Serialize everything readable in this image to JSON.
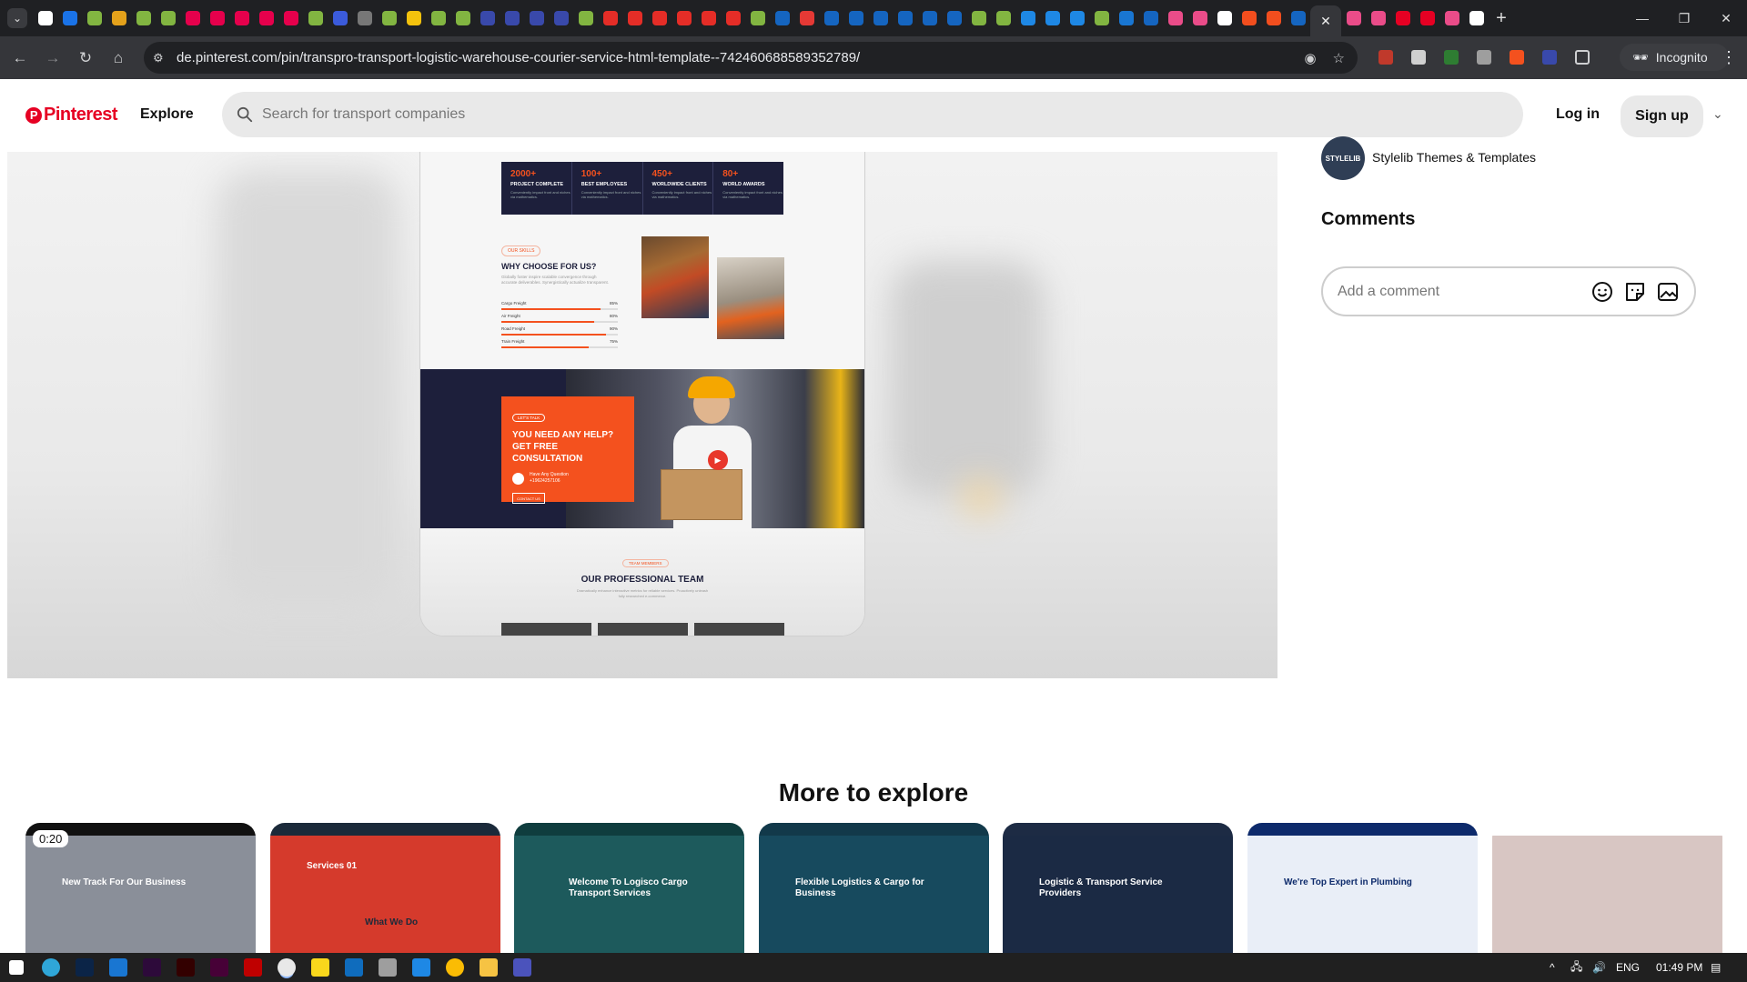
{
  "browser": {
    "tab_favicons": [
      {
        "name": "google-tab-icon",
        "color": "#ffffff"
      },
      {
        "name": "calendar-tab-icon",
        "color": "#1a73e8"
      },
      {
        "name": "envato-tab-icon",
        "color": "#82b541"
      },
      {
        "name": "brand-tab-icon",
        "color": "#e4a11b"
      },
      {
        "name": "envato-tab-icon",
        "color": "#82b541"
      },
      {
        "name": "envato-tab-icon",
        "color": "#82b541"
      },
      {
        "name": "opera-tab-icon",
        "color": "#e6004c"
      },
      {
        "name": "opera-tab-icon",
        "color": "#e6004c"
      },
      {
        "name": "opera-tab-icon",
        "color": "#e6004c"
      },
      {
        "name": "opera-tab-icon",
        "color": "#e6004c"
      },
      {
        "name": "opera-tab-icon",
        "color": "#e6004c"
      },
      {
        "name": "envato-tab-icon",
        "color": "#82b541"
      },
      {
        "name": "le-tab-icon",
        "color": "#3b5bdb"
      },
      {
        "name": "globe-tab-icon",
        "color": "#777777"
      },
      {
        "name": "envato-tab-icon",
        "color": "#82b541"
      },
      {
        "name": "wrench-tab-icon",
        "color": "#f4c20d"
      },
      {
        "name": "envato-tab-icon",
        "color": "#82b541"
      },
      {
        "name": "envato-tab-icon",
        "color": "#82b541"
      },
      {
        "name": "c-tab-icon",
        "color": "#3949ab"
      },
      {
        "name": "c-tab-icon",
        "color": "#3949ab"
      },
      {
        "name": "c-tab-icon",
        "color": "#3949ab"
      },
      {
        "name": "c-tab-icon",
        "color": "#3949ab"
      },
      {
        "name": "envato-tab-icon",
        "color": "#82b541"
      },
      {
        "name": "red-tab-icon",
        "color": "#e52d27"
      },
      {
        "name": "red-tab-icon",
        "color": "#e52d27"
      },
      {
        "name": "red-tab-icon",
        "color": "#e52d27"
      },
      {
        "name": "red-tab-icon",
        "color": "#e52d27"
      },
      {
        "name": "red-tab-icon",
        "color": "#e52d27"
      },
      {
        "name": "red-tab-icon",
        "color": "#e52d27"
      },
      {
        "name": "envato-tab-icon",
        "color": "#82b541"
      },
      {
        "name": "a-tab-icon",
        "color": "#1565c0"
      },
      {
        "name": "m-tab-icon",
        "color": "#e53935"
      },
      {
        "name": "a-tab-icon",
        "color": "#1565c0"
      },
      {
        "name": "a-tab-icon",
        "color": "#1565c0"
      },
      {
        "name": "a-tab-icon",
        "color": "#1565c0"
      },
      {
        "name": "a-tab-icon",
        "color": "#1565c0"
      },
      {
        "name": "a-tab-icon",
        "color": "#1565c0"
      },
      {
        "name": "a-tab-icon",
        "color": "#1565c0"
      },
      {
        "name": "envato-tab-icon",
        "color": "#82b541"
      },
      {
        "name": "envato-tab-icon",
        "color": "#82b541"
      },
      {
        "name": "edge-tab-icon",
        "color": "#1e88e5"
      },
      {
        "name": "edge-tab-icon",
        "color": "#1e88e5"
      },
      {
        "name": "edge-tab-icon",
        "color": "#1e88e5"
      },
      {
        "name": "envato-tab-icon",
        "color": "#82b541"
      },
      {
        "name": "word-tab-icon",
        "color": "#1976d2"
      },
      {
        "name": "forms-tab-icon",
        "color": "#1565c0"
      },
      {
        "name": "dribbble-tab-icon",
        "color": "#ea4c89"
      },
      {
        "name": "dribbble-tab-icon",
        "color": "#ea4c89"
      },
      {
        "name": "chrome-tab-icon",
        "color": "#ffffff"
      },
      {
        "name": "figma-tab-icon",
        "color": "#f24e1e"
      },
      {
        "name": "figma-tab-icon",
        "color": "#f24e1e"
      },
      {
        "name": "forms-tab-icon",
        "color": "#1565c0"
      }
    ],
    "active_tab_close": "✕",
    "tab_favicons_after": [
      {
        "name": "dribbble-tab-icon",
        "color": "#ea4c89"
      },
      {
        "name": "dribbble-tab-icon",
        "color": "#ea4c89"
      },
      {
        "name": "pinterest-tab-icon",
        "color": "#e60023"
      },
      {
        "name": "pinterest-tab-icon",
        "color": "#e60023"
      },
      {
        "name": "dribbble-tab-icon",
        "color": "#ea4c89"
      },
      {
        "name": "notion-tab-icon",
        "color": "#ffffff"
      }
    ],
    "new_tab": "+",
    "url": "de.pinterest.com/pin/transpro-transport-logistic-warehouse-courier-service-html-template--742460688589352789/",
    "incognito_label": "Incognito"
  },
  "header": {
    "logo_text": "Pinterest",
    "explore_label": "Explore",
    "search_placeholder": "Search for transport companies",
    "login_label": "Log in",
    "signup_label": "Sign up",
    "colors": {
      "brand": "#e60023"
    }
  },
  "pin": {
    "stats": [
      {
        "num": "2000+",
        "label": "PROJECT COMPLETE",
        "sub": "Conveniently impact front and niches via mathematics."
      },
      {
        "num": "100+",
        "label": "BEST EMPLOYEES",
        "sub": "Conveniently impact front and niches via mathematics."
      },
      {
        "num": "450+",
        "label": "WORLDWIDE CLIENTS",
        "sub": "Conveniently impact front and niches via mathematics."
      },
      {
        "num": "80+",
        "label": "WORLD AWARDS",
        "sub": "Conveniently impact front and niches via mathematics."
      }
    ],
    "why_tag": "OUR SKILLS",
    "why_title": "WHY CHOOSE FOR US?",
    "why_desc": "Globally foster inspire scalable convergence through accurate deliverables. Synergistically actualize transparent.",
    "skills": [
      {
        "label": "Cargo Freight",
        "value": "85%",
        "level": 0.85
      },
      {
        "label": "Air Freight",
        "value": "80%",
        "level": 0.8
      },
      {
        "label": "Road Freight",
        "value": "90%",
        "level": 0.9
      },
      {
        "label": "Train Freight",
        "value": "75%",
        "level": 0.75
      }
    ],
    "help_tag": "LET'S TALK",
    "help_title": "YOU NEED ANY HELP? GET FREE CONSULTATION",
    "help_phone_label": "Have Any Question",
    "help_phone": "+19624257106",
    "help_button": "CONTACT US",
    "team_tag": "TEAM MEMBERS",
    "team_title": "OUR PROFESSIONAL TEAM",
    "team_desc": "Dramatically enhance interactive metrics for reliable services. Proactively unleash fully researched e-commerce."
  },
  "side": {
    "author_avatar_text": "STYLELIB",
    "author_name": "Stylelib Themes & Templates",
    "comments_title": "Comments",
    "comment_placeholder": "Add a comment"
  },
  "more": {
    "title": "More to explore",
    "duration": "0:20",
    "cards": [
      {
        "headline": "New Track For Our Business",
        "nav_color": "#111111",
        "hero_color": "#8a8f99"
      },
      {
        "headline": "Services 01",
        "nav_color": "#1b2a3a",
        "hero_color": "#d53a2c"
      },
      {
        "headline": "Welcome To Logisco Cargo Transport Services",
        "nav_color": "#0f3d3e",
        "hero_color": "#1d5a5c"
      },
      {
        "headline": "Flexible Logistics & Cargo for Business",
        "nav_color": "#12394a",
        "hero_color": "#174a5e"
      },
      {
        "headline": "Logistic & Transport Service Providers",
        "nav_color": "#1d2b44",
        "hero_color": "#1b2a44"
      },
      {
        "headline": "We're Top Expert in Plumbing",
        "nav_color": "#0d2a6b",
        "hero_color": "#e9eef7"
      },
      {
        "headline": "",
        "nav_color": "#ffffff",
        "hero_color": "#d8c6c3"
      }
    ],
    "card_mid_label": "What We Do"
  },
  "taskbar": {
    "lang": "ENG",
    "time": "01:49 PM"
  }
}
